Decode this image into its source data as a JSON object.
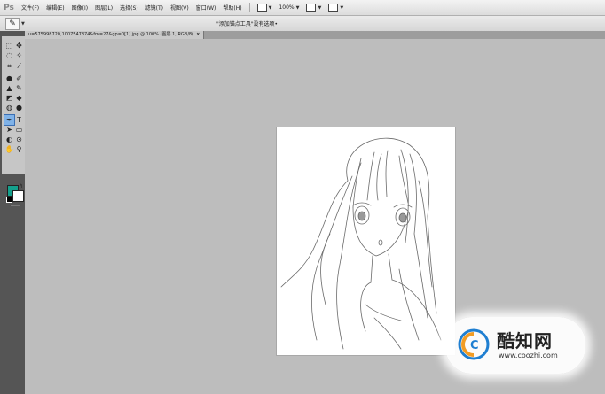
{
  "app": {
    "logo": "Ps"
  },
  "menubar": {
    "items": [
      "文件(F)",
      "编辑(E)",
      "图像(I)",
      "图层(L)",
      "选择(S)",
      "滤镜(T)",
      "视图(V)",
      "窗口(W)",
      "帮助(H)"
    ],
    "zoom": "100%"
  },
  "options": {
    "hint": "\"添加锚点工具\"没有选项•",
    "preset_icon": "pen-add-anchor-icon"
  },
  "document": {
    "tab_title": "u=575998720,1007547874&fm=27&gp=0[1].jpg @ 100% (图层 1, RGB/8)",
    "close": "×"
  },
  "colors": {
    "foreground": "#14a08c",
    "background": "#ffffff"
  },
  "watermark": {
    "name": "酷知网",
    "url": "www.coozhi.com"
  }
}
